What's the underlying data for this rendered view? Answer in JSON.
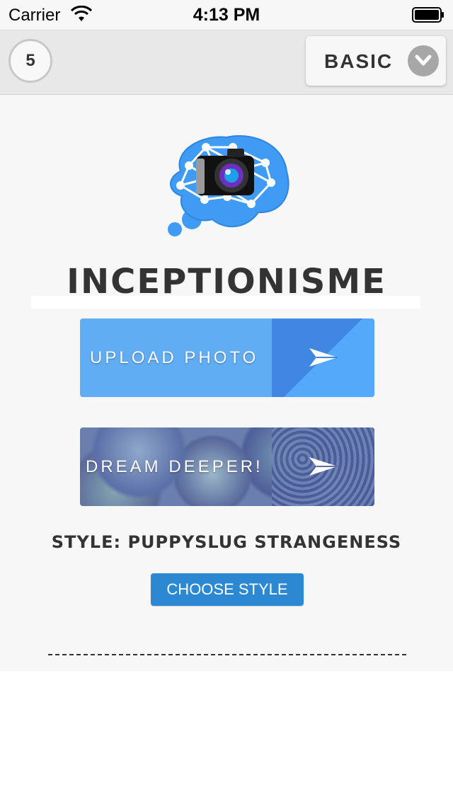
{
  "status_bar": {
    "carrier": "Carrier",
    "time": "4:13 PM"
  },
  "toolbar": {
    "count": "5",
    "mode": "BASIC"
  },
  "main": {
    "app_title": "INCEPTIONISME",
    "upload_label": "UPLOAD PHOTO",
    "dream_label": "DREAM DEEPER!",
    "style_label": "STYLE: PUPPYSLUG STRANGENESS",
    "choose_style_label": "CHOOSE STYLE"
  },
  "colors": {
    "toolbar_bg": "#e8e8e8",
    "upload_button": "#61adf4",
    "choose_style_button": "#2d88d2",
    "logo_brain": "#3f9bf4"
  },
  "icons": {
    "wifi": "wifi-icon",
    "battery": "battery-icon",
    "chevron": "chevron-down-icon",
    "logo": "brain-camera-logo",
    "send": "send-arrow-icon"
  }
}
